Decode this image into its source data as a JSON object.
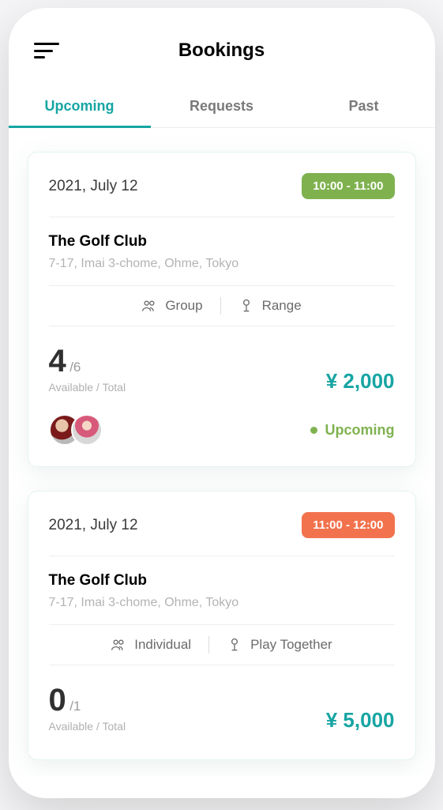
{
  "header": {
    "title": "Bookings"
  },
  "tabs": [
    {
      "label": "Upcoming",
      "active": true
    },
    {
      "label": "Requests",
      "active": false
    },
    {
      "label": "Past",
      "active": false
    }
  ],
  "bookings": [
    {
      "date": "2021, July 12",
      "time": "10:00 - 11:00",
      "time_color": "green",
      "venue_name": "The Golf Club",
      "venue_address": "7-17, Imai 3-chome, Ohme, Tokyo",
      "group_type": "Group",
      "play_type": "Range",
      "slots_available": "4",
      "slots_total": "/6",
      "slots_caption": "Available / Total",
      "price": "¥ 2,000",
      "status": "Upcoming",
      "avatars": 2
    },
    {
      "date": "2021, July 12",
      "time": "11:00 - 12:00",
      "time_color": "orange",
      "venue_name": "The Golf Club",
      "venue_address": "7-17, Imai 3-chome, Ohme, Tokyo",
      "group_type": "Individual",
      "play_type": "Play Together",
      "slots_available": "0",
      "slots_total": "/1",
      "slots_caption": "Available / Total",
      "price": "¥ 5,000"
    }
  ]
}
